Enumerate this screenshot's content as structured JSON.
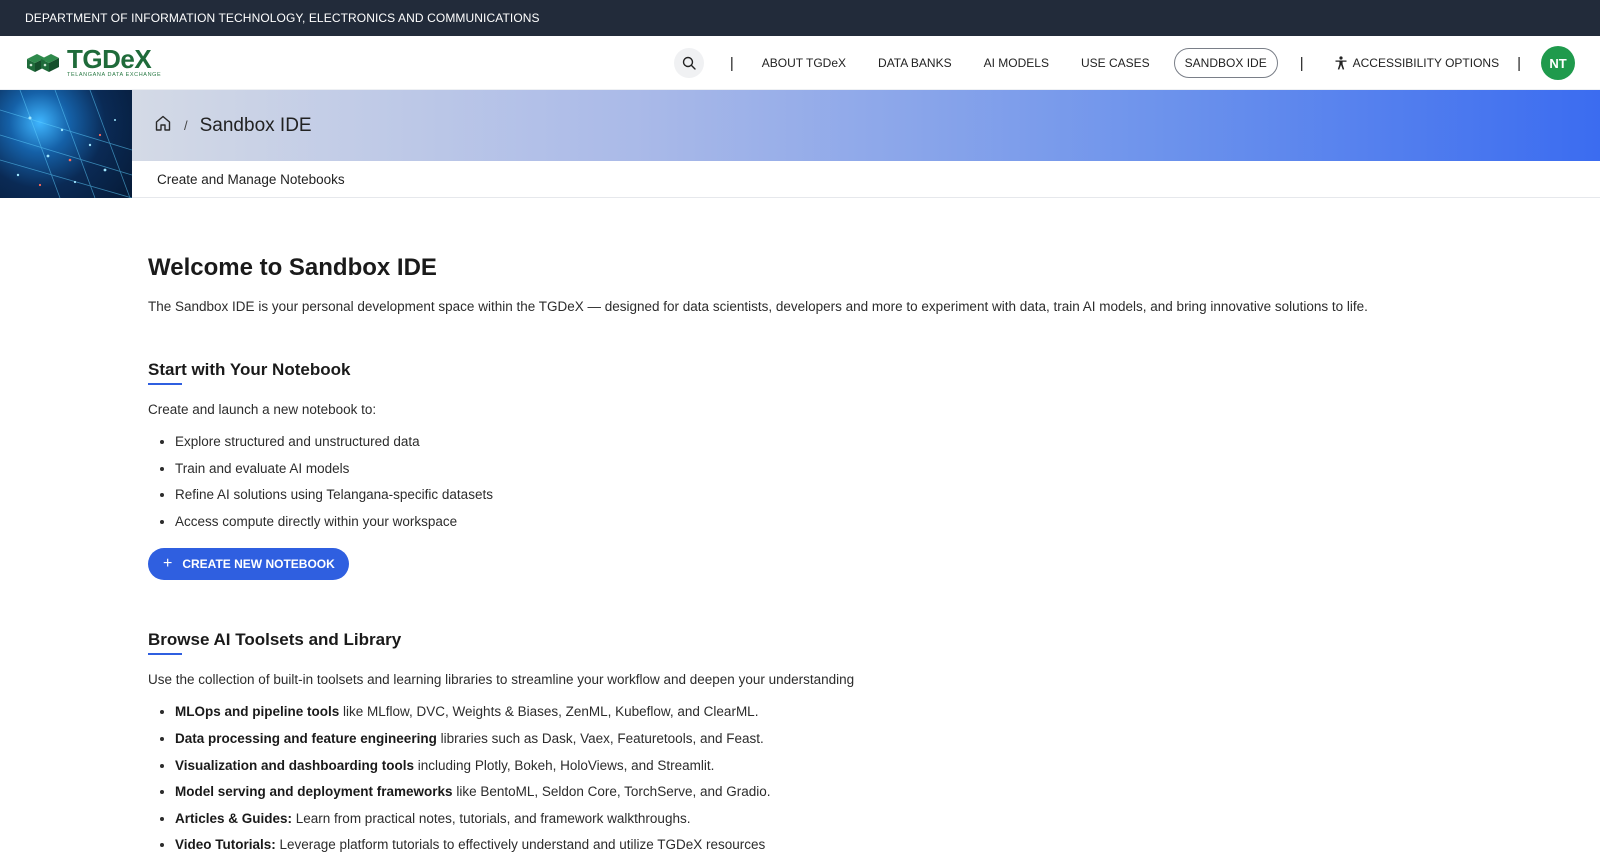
{
  "topbar": {
    "department": "DEPARTMENT OF INFORMATION TECHNOLOGY, ELECTRONICS AND COMMUNICATIONS"
  },
  "logo": {
    "name": "TGDeX",
    "tagline": "TELANGANA DATA EXCHANGE"
  },
  "nav": {
    "separator": "|",
    "links": [
      "ABOUT TGDeX",
      "DATA BANKS",
      "AI MODELS",
      "USE CASES",
      "SANDBOX IDE"
    ],
    "active_link": "SANDBOX IDE",
    "accessibility": "ACCESSIBILITY OPTIONS",
    "avatar_initials": "NT"
  },
  "hero": {
    "breadcrumb_sep": "/",
    "title": "Sandbox IDE",
    "subtitle": "Create and Manage Notebooks"
  },
  "main": {
    "heading": "Welcome to Sandbox IDE",
    "intro": "The Sandbox IDE is your personal development space within the TGDeX — designed for data scientists, developers and more to experiment with data, train AI models, and bring innovative solutions to life.",
    "notebook": {
      "heading": "Start with Your Notebook",
      "lead": "Create and launch a new notebook to:",
      "items": [
        "Explore structured and unstructured data",
        "Train and evaluate AI models",
        "Refine AI solutions using Telangana-specific datasets",
        "Access compute directly within your workspace"
      ],
      "button_icon": "+",
      "button_label": "CREATE NEW NOTEBOOK"
    },
    "toolsets": {
      "heading": "Browse AI Toolsets and Library",
      "lead": "Use the collection of built-in toolsets and learning libraries to streamline your workflow and deepen your understanding",
      "items": [
        {
          "bold": "MLOps and pipeline tools",
          "text": " like MLflow, DVC, Weights & Biases, ZenML, Kubeflow, and ClearML."
        },
        {
          "bold": "Data processing and feature engineering",
          "text": " libraries such as Dask, Vaex, Featuretools, and Feast."
        },
        {
          "bold": "Visualization and dashboarding tools",
          "text": " including Plotly, Bokeh, HoloViews, and Streamlit."
        },
        {
          "bold": "Model serving and deployment frameworks",
          "text": " like BentoML, Seldon Core, TorchServe, and Gradio."
        },
        {
          "bold": "Articles & Guides:",
          "text": " Learn from practical notes, tutorials, and framework walkthroughs."
        },
        {
          "bold": "Video Tutorials:",
          "text": " Leverage platform tutorials to effectively understand and utilize TGDeX resources"
        }
      ]
    }
  },
  "icons": {
    "search": "search-icon",
    "home": "home-icon",
    "accessibility": "accessibility-icon",
    "plus": "plus-icon"
  },
  "colors": {
    "topbar_bg": "#222b3a",
    "brand_green": "#1f6b3a",
    "accent_blue": "#2f5fe0",
    "avatar_green": "#1f9a4c"
  }
}
